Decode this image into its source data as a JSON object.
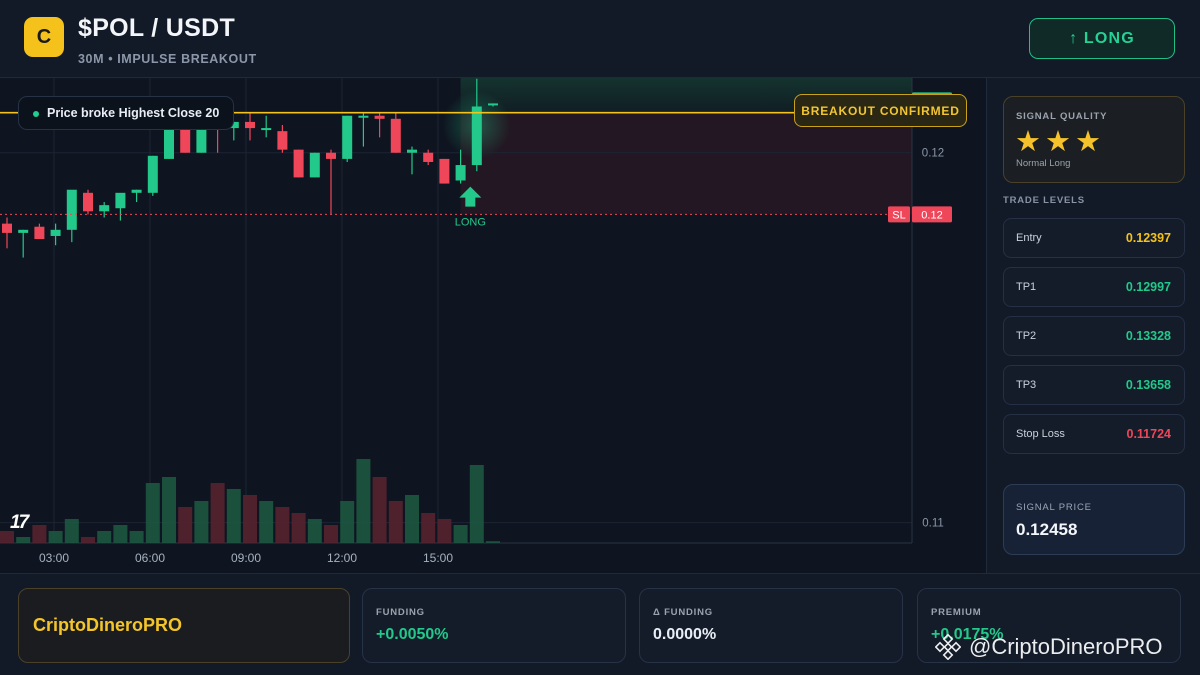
{
  "header": {
    "logo_letter": "C",
    "pair": "$POL / USDT",
    "subtitle": "30M • IMPULSE BREAKOUT",
    "long_button": "↑ LONG"
  },
  "chart": {
    "annotation": "Price broke Highest Close 20",
    "confirm_badge": "BREAKOUT CONFIRMED",
    "signal_marker_label": "LONG",
    "breakout_label": "BREAKOUT",
    "breakout_value": "0.12",
    "sl_label": "SL",
    "sl_value": "0.12",
    "last_price_value": "0.12",
    "y_ticks": [
      "0.12",
      "0.11"
    ],
    "x_ticks": [
      "03:00",
      "06:00",
      "09:00",
      "12:00",
      "15:00"
    ],
    "tv_logo": "17",
    "colors": {
      "up": "#22c98a",
      "down": "#f0465a",
      "breakout": "#f5c21b",
      "sl": "#f0465a"
    }
  },
  "chart_data": {
    "type": "candlestick",
    "timeframe": "30M",
    "ylim": [
      0.1098,
      0.1243
    ],
    "levels": {
      "breakout": 0.1235,
      "stop_loss": 0.1202,
      "last": 0.1238
    },
    "candles": [
      {
        "o": 0.1199,
        "h": 0.1201,
        "l": 0.1191,
        "c": 0.1196
      },
      {
        "o": 0.1196,
        "h": 0.1197,
        "l": 0.1188,
        "c": 0.1197
      },
      {
        "o": 0.1198,
        "h": 0.1199,
        "l": 0.1194,
        "c": 0.1194
      },
      {
        "o": 0.1195,
        "h": 0.1199,
        "l": 0.1192,
        "c": 0.1197
      },
      {
        "o": 0.1197,
        "h": 0.1209,
        "l": 0.1193,
        "c": 0.121
      },
      {
        "o": 0.1209,
        "h": 0.121,
        "l": 0.1202,
        "c": 0.1203
      },
      {
        "o": 0.1203,
        "h": 0.1206,
        "l": 0.1201,
        "c": 0.1205
      },
      {
        "o": 0.1204,
        "h": 0.1208,
        "l": 0.12,
        "c": 0.1209
      },
      {
        "o": 0.1209,
        "h": 0.121,
        "l": 0.1206,
        "c": 0.121
      },
      {
        "o": 0.1209,
        "h": 0.1221,
        "l": 0.1208,
        "c": 0.1221
      },
      {
        "o": 0.122,
        "h": 0.1232,
        "l": 0.122,
        "c": 0.1232
      },
      {
        "o": 0.1232,
        "h": 0.1232,
        "l": 0.1222,
        "c": 0.1222
      },
      {
        "o": 0.1222,
        "h": 0.1234,
        "l": 0.1222,
        "c": 0.1231
      },
      {
        "o": 0.1231,
        "h": 0.1234,
        "l": 0.1222,
        "c": 0.123
      },
      {
        "o": 0.123,
        "h": 0.1232,
        "l": 0.1226,
        "c": 0.1232
      },
      {
        "o": 0.1232,
        "h": 0.1235,
        "l": 0.1226,
        "c": 0.123
      },
      {
        "o": 0.123,
        "h": 0.1234,
        "l": 0.1227,
        "c": 0.123
      },
      {
        "o": 0.1229,
        "h": 0.1231,
        "l": 0.1222,
        "c": 0.1223
      },
      {
        "o": 0.1223,
        "h": 0.1223,
        "l": 0.1214,
        "c": 0.1214
      },
      {
        "o": 0.1214,
        "h": 0.1222,
        "l": 0.1214,
        "c": 0.1222
      },
      {
        "o": 0.1222,
        "h": 0.1223,
        "l": 0.1202,
        "c": 0.122
      },
      {
        "o": 0.122,
        "h": 0.1234,
        "l": 0.1219,
        "c": 0.1234
      },
      {
        "o": 0.1234,
        "h": 0.1235,
        "l": 0.1224,
        "c": 0.1234
      },
      {
        "o": 0.1234,
        "h": 0.1235,
        "l": 0.1227,
        "c": 0.1233
      },
      {
        "o": 0.1233,
        "h": 0.1235,
        "l": 0.1222,
        "c": 0.1222
      },
      {
        "o": 0.1222,
        "h": 0.1224,
        "l": 0.1215,
        "c": 0.1223
      },
      {
        "o": 0.1222,
        "h": 0.1223,
        "l": 0.1218,
        "c": 0.1219
      },
      {
        "o": 0.122,
        "h": 0.122,
        "l": 0.1212,
        "c": 0.1212
      },
      {
        "o": 0.1213,
        "h": 0.1223,
        "l": 0.1212,
        "c": 0.1218
      },
      {
        "o": 0.1218,
        "h": 0.1246,
        "l": 0.1216,
        "c": 0.1237
      },
      {
        "o": 0.1238,
        "h": 0.1238,
        "l": 0.1237,
        "c": 0.1238
      }
    ],
    "volume": [
      2,
      1,
      3,
      2,
      4,
      1,
      2,
      3,
      2,
      10,
      11,
      6,
      7,
      10,
      9,
      8,
      7,
      6,
      5,
      4,
      3,
      7,
      14,
      11,
      7,
      8,
      5,
      4,
      3,
      13,
      0.3
    ]
  },
  "side": {
    "quality_title": "SIGNAL QUALITY",
    "stars": "★★★",
    "quality_sub": "Normal Long",
    "levels_title": "TRADE LEVELS",
    "levels": [
      {
        "label": "Entry",
        "value": "0.12397",
        "color": "#f5c21b"
      },
      {
        "label": "TP1",
        "value": "0.12997",
        "color": "#22c98a"
      },
      {
        "label": "TP2",
        "value": "0.13328",
        "color": "#22c98a"
      },
      {
        "label": "TP3",
        "value": "0.13658",
        "color": "#22c98a"
      },
      {
        "label": "Stop Loss",
        "value": "0.11724",
        "color": "#f0465a"
      }
    ],
    "signal_price_label": "SIGNAL PRICE",
    "signal_price": "0.12458"
  },
  "footer": {
    "brand": "CriptoDineroPRO",
    "cards": [
      {
        "label": "FUNDING",
        "value": "+0.0050%",
        "color": "#22c98a"
      },
      {
        "label": "Δ FUNDING",
        "value": "0.0000%",
        "color": "#e9eef5"
      },
      {
        "label": "PREMIUM",
        "value": "+0.0175%",
        "color": "#22c98a"
      }
    ],
    "watermark": "@CriptoDineroPRO"
  }
}
